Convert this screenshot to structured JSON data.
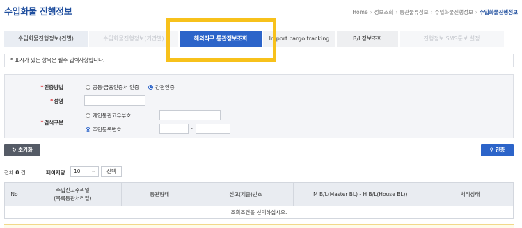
{
  "page": {
    "title": "수입화물 진행정보",
    "breadcrumb": [
      "Home",
      "정보조회",
      "통관물류정보",
      "수입화물진행정보",
      "수입화물진행정보"
    ]
  },
  "tabs": [
    {
      "label": "수입화물진행정보(건별)",
      "state": "normal"
    },
    {
      "label": "수입화물진행정보(기간별)",
      "state": "disabled"
    },
    {
      "label": "해외직구 통관정보조회",
      "state": "active"
    },
    {
      "label": "Import cargo tracking",
      "state": "normal"
    },
    {
      "label": "B/L정보조회",
      "state": "normal"
    },
    {
      "label": "진행정보 SMS통보 설정",
      "state": "disabled"
    }
  ],
  "notice": "* 표시가 있는 항목은 필수 입력사항입니다.",
  "form": {
    "auth_method": {
      "label": "인증방법",
      "options": [
        "공동·금융인증서 인증",
        "간편인증"
      ],
      "selected": "간편인증"
    },
    "name": {
      "label": "성명",
      "value": ""
    },
    "search_type": {
      "label": "검색구분",
      "options": [
        "개인통관고유부호",
        "주민등록번호"
      ],
      "selected": "주민등록번호",
      "dash": "-"
    }
  },
  "buttons": {
    "reset": "초기화",
    "auth": "인증",
    "select": "선택"
  },
  "results": {
    "total_prefix": "전체",
    "total_count": "0",
    "total_suffix": "건",
    "per_page_label": "페이지당",
    "per_page_value": "10",
    "columns": [
      "No",
      "수입신고수리일\n(목록통관처리일)",
      "통관형태",
      "신고(제출)번호",
      "M B/L(Master BL) - H B/L(House BL))",
      "처리상태"
    ],
    "empty_message": "조회조건을 선택하십시오."
  },
  "colors": {
    "primary": "#2c64c9",
    "title": "#1f4e9e",
    "highlight": "#f7c11b",
    "required": "#d9262c"
  }
}
